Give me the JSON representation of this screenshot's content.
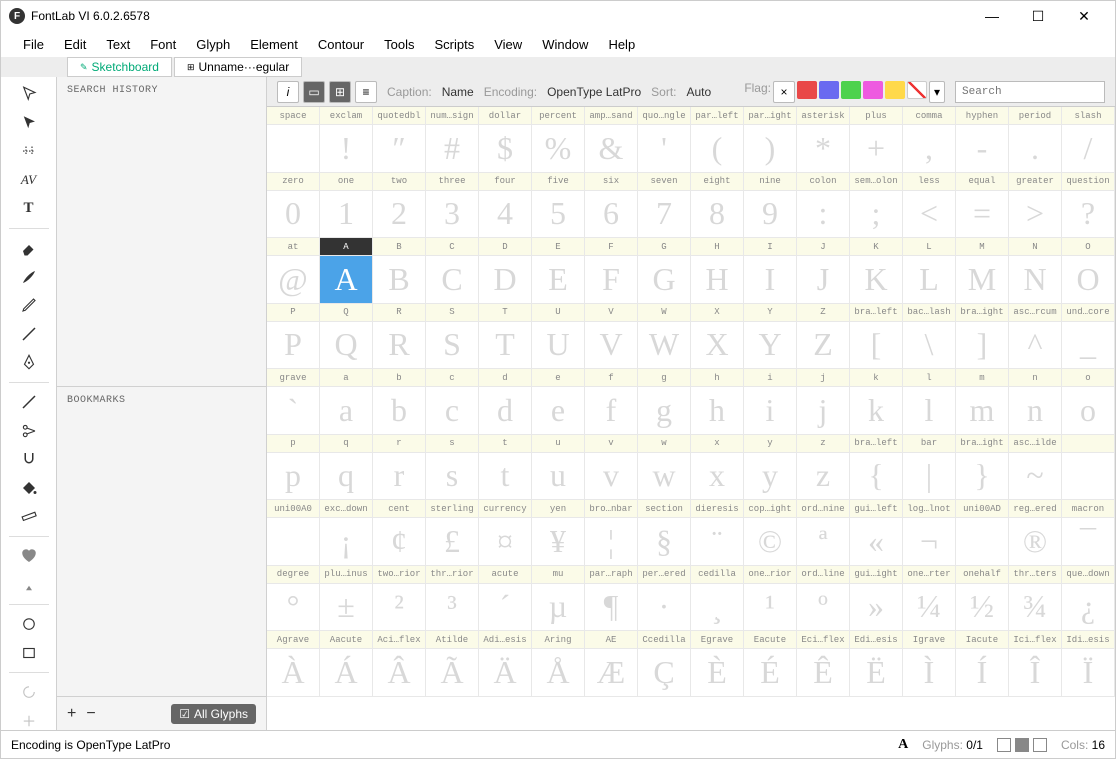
{
  "app": {
    "title": "FontLab VI 6.0.2.6578",
    "icon_letter": "F"
  },
  "menu": [
    "File",
    "Edit",
    "Text",
    "Font",
    "Glyph",
    "Element",
    "Contour",
    "Tools",
    "Scripts",
    "View",
    "Window",
    "Help"
  ],
  "tabs": [
    {
      "label": "Sketchboard",
      "icon": "✎",
      "kind": "sketch"
    },
    {
      "label": "Unname···egular",
      "icon": "⊞",
      "kind": "font"
    }
  ],
  "left_panel": {
    "search_history": "SEARCH HISTORY",
    "bookmarks": "BOOKMARKS",
    "all_glyphs": "All Glyphs"
  },
  "font_toolbar": {
    "caption_label": "Caption:",
    "caption_value": "Name",
    "encoding_label": "Encoding:",
    "encoding_value": "OpenType LatPro",
    "sort_label": "Sort:",
    "sort_value": "Auto",
    "flag_label": "Flag:",
    "search_placeholder": "Search"
  },
  "flag_colors": [
    "#e94848",
    "#6a6af0",
    "#4dd24d",
    "#ee5be0",
    "#ffd94a"
  ],
  "rows": [
    {
      "labels": [
        "space",
        "exclam",
        "quotedbl",
        "num…sign",
        "dollar",
        "percent",
        "amp…sand",
        "quo…ngle",
        "par…left",
        "par…ight",
        "asterisk",
        "plus",
        "comma",
        "hyphen",
        "period",
        "slash"
      ],
      "chars": [
        " ",
        "!",
        "″",
        "#",
        "$",
        "%",
        "&",
        "'",
        "(",
        ")",
        "*",
        "+",
        ",",
        "-",
        ".",
        "/"
      ]
    },
    {
      "labels": [
        "zero",
        "one",
        "two",
        "three",
        "four",
        "five",
        "six",
        "seven",
        "eight",
        "nine",
        "colon",
        "sem…olon",
        "less",
        "equal",
        "greater",
        "question"
      ],
      "chars": [
        "0",
        "1",
        "2",
        "3",
        "4",
        "5",
        "6",
        "7",
        "8",
        "9",
        ":",
        ";",
        "<",
        "=",
        ">",
        "?"
      ]
    },
    {
      "labels": [
        "at",
        "A",
        "B",
        "C",
        "D",
        "E",
        "F",
        "G",
        "H",
        "I",
        "J",
        "K",
        "L",
        "M",
        "N",
        "O"
      ],
      "chars": [
        "@",
        "A",
        "B",
        "C",
        "D",
        "E",
        "F",
        "G",
        "H",
        "I",
        "J",
        "K",
        "L",
        "M",
        "N",
        "O"
      ],
      "selected": 1
    },
    {
      "labels": [
        "P",
        "Q",
        "R",
        "S",
        "T",
        "U",
        "V",
        "W",
        "X",
        "Y",
        "Z",
        "bra…left",
        "bac…lash",
        "bra…ight",
        "asc…rcum",
        "und…core"
      ],
      "chars": [
        "P",
        "Q",
        "R",
        "S",
        "T",
        "U",
        "V",
        "W",
        "X",
        "Y",
        "Z",
        "[",
        "\\",
        "]",
        "^",
        "_"
      ]
    },
    {
      "labels": [
        "grave",
        "a",
        "b",
        "c",
        "d",
        "e",
        "f",
        "g",
        "h",
        "i",
        "j",
        "k",
        "l",
        "m",
        "n",
        "o"
      ],
      "chars": [
        "`",
        "a",
        "b",
        "c",
        "d",
        "e",
        "f",
        "g",
        "h",
        "i",
        "j",
        "k",
        "l",
        "m",
        "n",
        "o"
      ]
    },
    {
      "labels": [
        "p",
        "q",
        "r",
        "s",
        "t",
        "u",
        "v",
        "w",
        "x",
        "y",
        "z",
        "bra…left",
        "bar",
        "bra…ight",
        "asc…ilde",
        ""
      ],
      "chars": [
        "p",
        "q",
        "r",
        "s",
        "t",
        "u",
        "v",
        "w",
        "x",
        "y",
        "z",
        "{",
        "|",
        "}",
        "~",
        ""
      ]
    },
    {
      "labels": [
        "uni00A0",
        "exc…down",
        "cent",
        "sterling",
        "currency",
        "yen",
        "bro…nbar",
        "section",
        "dieresis",
        "cop…ight",
        "ord…nine",
        "gui…left",
        "log…lnot",
        "uni00AD",
        "reg…ered",
        "macron"
      ],
      "chars": [
        " ",
        "¡",
        "¢",
        "£",
        "¤",
        "¥",
        "¦",
        "§",
        "¨",
        "©",
        "ª",
        "«",
        "¬",
        "",
        "®",
        "¯"
      ]
    },
    {
      "labels": [
        "degree",
        "plu…inus",
        "two…rior",
        "thr…rior",
        "acute",
        "mu",
        "par…raph",
        "per…ered",
        "cedilla",
        "one…rior",
        "ord…line",
        "gui…ight",
        "one…rter",
        "onehalf",
        "thr…ters",
        "que…down"
      ],
      "chars": [
        "°",
        "±",
        "²",
        "³",
        "´",
        "µ",
        "¶",
        "·",
        "¸",
        "¹",
        "º",
        "»",
        "¼",
        "½",
        "¾",
        "¿"
      ]
    },
    {
      "labels": [
        "Agrave",
        "Aacute",
        "Aci…flex",
        "Atilde",
        "Adi…esis",
        "Aring",
        "AE",
        "Ccedilla",
        "Egrave",
        "Eacute",
        "Eci…flex",
        "Edi…esis",
        "Igrave",
        "Iacute",
        "Ici…flex",
        "Idi…esis"
      ],
      "chars": [
        "À",
        "Á",
        "Â",
        "Ã",
        "Ä",
        "Å",
        "Æ",
        "Ç",
        "È",
        "É",
        "Ê",
        "Ë",
        "Ì",
        "Í",
        "Î",
        "Ï"
      ]
    }
  ],
  "status": {
    "encoding": "Encoding is OpenType LatPro",
    "glyph_icon": "A",
    "glyphs_label": "Glyphs:",
    "glyphs_value": "0/1",
    "cols_label": "Cols:",
    "cols_value": "16"
  }
}
